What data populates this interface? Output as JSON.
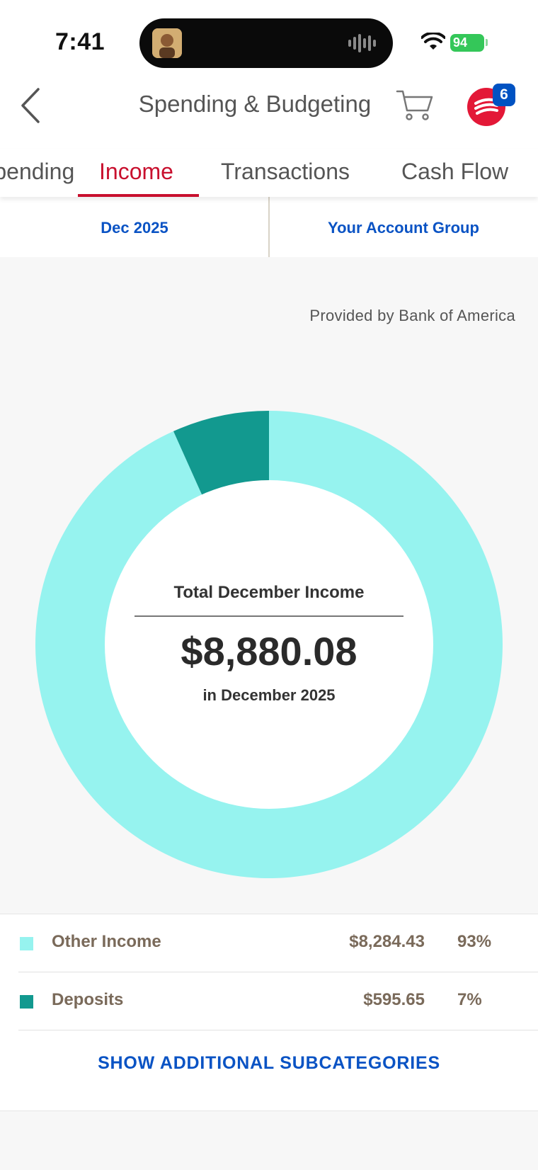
{
  "status_bar": {
    "time": "7:41",
    "battery": "94"
  },
  "header": {
    "title": "Spending & Budgeting",
    "notification_count": "6"
  },
  "tabs": [
    {
      "label": "Spending"
    },
    {
      "label": "Income"
    },
    {
      "label": "Transactions"
    },
    {
      "label": "Cash Flow"
    }
  ],
  "filters": {
    "date": "Dec 2025",
    "account": "Your Account Group"
  },
  "provider_note": "Provided by Bank of America",
  "summary": {
    "title": "Total December Income",
    "amount": "$8,880.08",
    "subtitle": "in December 2025"
  },
  "colors": {
    "accent_red": "#c8102e",
    "link_blue": "#0a53c4",
    "other_income": "#96f3ef",
    "deposits": "#12998f"
  },
  "chart_data": {
    "type": "pie",
    "categories": [
      "Other Income",
      "Deposits"
    ],
    "values": [
      8284.43,
      595.65
    ]
  },
  "legend": [
    {
      "label": "Other Income",
      "value": "$8,284.43",
      "percent": "93%"
    },
    {
      "label": "Deposits",
      "value": "$595.65",
      "percent": "7%"
    }
  ],
  "actions": {
    "show_more": "SHOW ADDITIONAL SUBCATEGORIES"
  }
}
